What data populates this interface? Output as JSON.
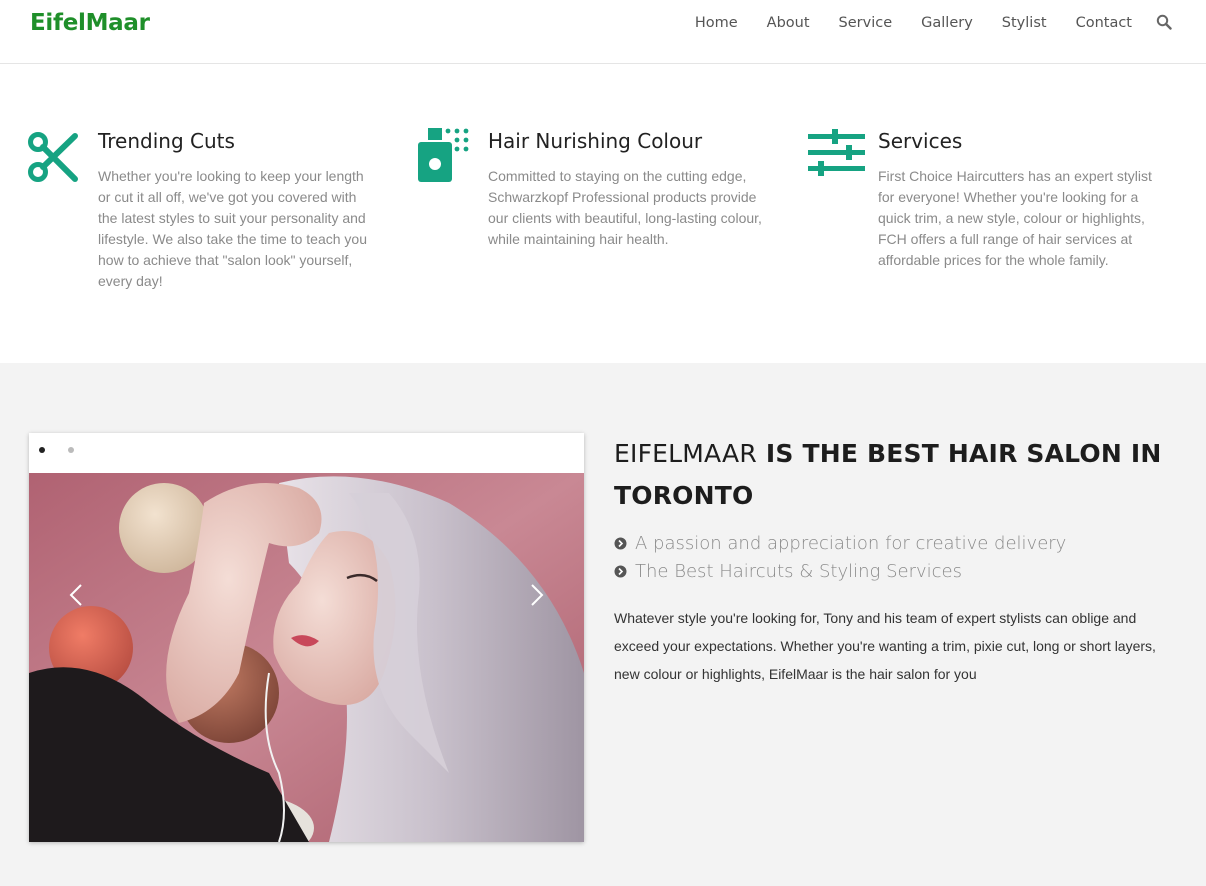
{
  "header": {
    "logo": "EifelMaar",
    "nav": [
      "Home",
      "About",
      "Service",
      "Gallery",
      "Stylist",
      "Contact"
    ]
  },
  "features": [
    {
      "icon": "scissors-icon",
      "title": "Trending Cuts",
      "text": "Whether you're looking to keep your length or cut it all off, we've got you covered with the latest styles to suit your personality and lifestyle. We also take the time to teach you how to achieve that \"salon look\" yourself, every day!"
    },
    {
      "icon": "spray-bottle-icon",
      "title": "Hair Nurishing Colour",
      "text": "Committed to staying on the cutting edge, Schwarzkopf Professional products provide our clients with beautiful, long-lasting colour, while maintaining hair health."
    },
    {
      "icon": "sliders-icon",
      "title": "Services",
      "text": "First Choice Haircutters has an expert stylist for everyone! Whether you're looking for a quick trim, a new style, colour or highlights, FCH offers a full range of hair services at affordable prices for the whole family."
    }
  ],
  "about": {
    "title_bold_light": "EIFELMAAR",
    "title_rest": "IS THE BEST HAIR SALON IN TORONTO",
    "bullets": [
      " A passion and appreciation for creative delivery",
      "The Best Haircuts & Styling Services"
    ],
    "text": "Whatever style you're looking for, Tony and his team of expert stylists can oblige and exceed your expectations. Whether you're wanting a trim, pixie cut, long or short layers, new colour or highlights, EifelMaar is the hair salon for you"
  },
  "slider": {
    "slide_count": 2,
    "active_slide": 1
  },
  "colors": {
    "brand": "#1f8f2a",
    "accent": "#16a382",
    "section_bg": "#f3f3f3"
  }
}
